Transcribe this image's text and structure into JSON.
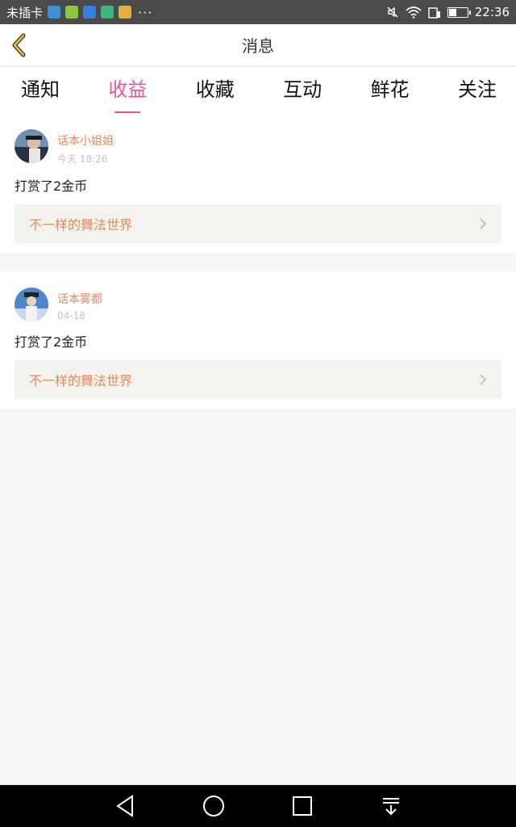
{
  "status_bar": {
    "carrier": "未插卡",
    "overflow": "···",
    "time": "22:36",
    "icons": [
      "app-icon-1",
      "app-icon-2",
      "app-icon-3",
      "app-icon-4",
      "app-icon-5",
      "mute-icon",
      "wifi-icon",
      "signal-icon",
      "battery-icon"
    ],
    "battery_level": 0.4
  },
  "header": {
    "title": "消息",
    "back_icon": "chevron-left-icon"
  },
  "tabs": [
    {
      "label": "通知",
      "active": false
    },
    {
      "label": "收益",
      "active": true
    },
    {
      "label": "收藏",
      "active": false
    },
    {
      "label": "互动",
      "active": false
    },
    {
      "label": "鲜花",
      "active": false
    },
    {
      "label": "关注",
      "active": false
    }
  ],
  "messages": [
    {
      "username": "话本小姐姐",
      "time": "今天 18:26",
      "text": "打赏了2金币",
      "work_title": "不一样的舞法世界"
    },
    {
      "username": "话本雾都",
      "time": "04-18",
      "text": "打赏了2金币",
      "work_title": "不一样的舞法世界"
    }
  ],
  "colors": {
    "accent": "#e5579a",
    "username": "#e8875a",
    "work_bg": "#f3f2ec"
  }
}
